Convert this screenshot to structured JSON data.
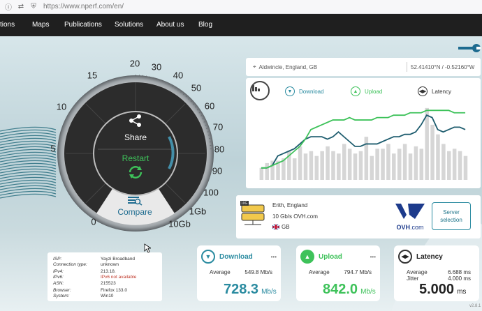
{
  "browser": {
    "url": "https://www.nperf.com/en/"
  },
  "nav": {
    "items": [
      "tions",
      "Maps",
      "Publications",
      "Solutions",
      "About us",
      "Blog"
    ]
  },
  "gauge": {
    "ticks": [
      "0",
      "5",
      "10",
      "15",
      "20",
      "30",
      "40",
      "50",
      "60",
      "70",
      "80",
      "90",
      "100",
      "1Gb",
      "10Gb"
    ],
    "share_label": "Share",
    "restart_label": "Restart",
    "compare_label": "Compare"
  },
  "location": {
    "city": "Aldwincle, England, GB",
    "coords": "52.41410°N / -0.52160°W"
  },
  "chart_legend": {
    "download": "Download",
    "upload": "Upload",
    "latency": "Latency"
  },
  "chart_data": {
    "type": "bar",
    "bars": [
      5,
      7,
      8,
      8,
      9,
      12,
      9,
      14,
      11,
      12,
      10,
      12,
      14,
      12,
      11,
      15,
      13,
      11,
      12,
      18,
      10,
      13,
      13,
      15,
      11,
      13,
      15,
      11,
      14,
      13,
      30,
      23,
      19,
      15,
      12,
      13,
      12,
      10
    ],
    "series": [
      {
        "name": "Download",
        "values": [
          5,
          5,
          6,
          10,
          11,
          12,
          13,
          15,
          17,
          18,
          18,
          18,
          17,
          18,
          20,
          18,
          16,
          14,
          14,
          15,
          15,
          15,
          16,
          17,
          18,
          18,
          19,
          19,
          20,
          23,
          27,
          26,
          21,
          20,
          21,
          22,
          22,
          21
        ]
      },
      {
        "name": "Upload",
        "values": [
          5,
          5,
          6,
          7,
          8,
          10,
          12,
          14,
          17,
          21,
          22,
          23,
          24,
          25,
          25,
          25,
          26,
          25,
          25,
          25,
          25,
          26,
          26,
          26,
          27,
          27,
          27,
          28,
          28,
          28,
          29,
          29,
          29,
          29,
          29,
          28,
          28,
          28
        ]
      }
    ]
  },
  "server": {
    "location": "Erith, England",
    "isp": "10 Gb/s OVH.com",
    "country": "GB",
    "brand": "OVH",
    "brand_suffix": ".com",
    "button": "Server selection",
    "badge": "10G"
  },
  "isp_info": {
    "rows": [
      {
        "k": "ISP:",
        "v": "Yayzi Broadband"
      },
      {
        "k": "Connection type:",
        "v": "unknown"
      },
      {
        "k": "IPv4:",
        "v": "213.18."
      },
      {
        "k": "IPv6:",
        "v": "IPv6 not available"
      },
      {
        "k": "ASN:",
        "v": "215523"
      },
      {
        "k": "Browser:",
        "v": "Firefox 133.0"
      },
      {
        "k": "System:",
        "v": "Win10"
      }
    ]
  },
  "download": {
    "title": "Download",
    "avg_label": "Average",
    "avg": "549.8 Mb/s",
    "value": "728.3",
    "unit": "Mb/s",
    "color": "#2a8ba0"
  },
  "upload": {
    "title": "Upload",
    "avg_label": "Average",
    "avg": "794.7 Mb/s",
    "value": "842.0",
    "unit": "Mb/s",
    "color": "#3ec25a"
  },
  "latency": {
    "title": "Latency",
    "avg_label": "Average",
    "avg": "6.688 ms",
    "jitter_label": "Jitter",
    "jitter": "4.000 ms",
    "value": "5.000",
    "unit": "ms"
  },
  "version": "v2.8.1"
}
